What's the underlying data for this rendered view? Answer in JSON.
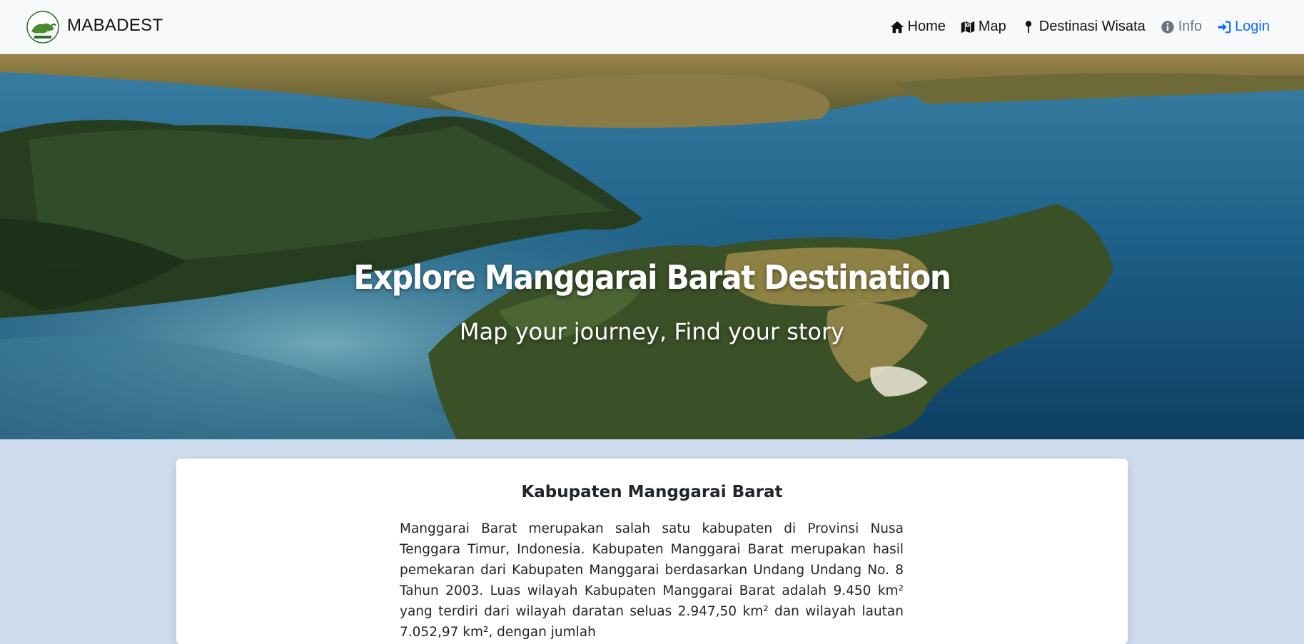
{
  "navbar": {
    "brand_name": "MABADEST",
    "logo_icon": "komodo-logo-icon",
    "links": [
      {
        "label": "Home",
        "icon": "home-icon"
      },
      {
        "label": "Map",
        "icon": "map-icon"
      },
      {
        "label": "Destinasi Wisata",
        "icon": "map-pin-icon"
      },
      {
        "label": "Info",
        "icon": "info-circle-icon"
      },
      {
        "label": "Login",
        "icon": "login-icon"
      }
    ]
  },
  "hero": {
    "title": "Explore Manggarai Barat Destination",
    "subtitle": "Map your journey, Find your story"
  },
  "card": {
    "title": "Kabupaten Manggarai Barat",
    "body": "Manggarai Barat merupakan salah satu kabupaten di Provinsi Nusa Tenggara Timur, Indonesia. Kabupaten Manggarai Barat merupakan hasil pemekaran dari Kabupaten Manggarai berdasarkan Undang Undang No. 8 Tahun 2003. Luas wilayah Kabupaten Manggarai Barat adalah 9.450 km² yang terdiri dari wilayah daratan seluas 2.947,50 km² dan wilayah lautan 7.052,97 km², dengan jumlah"
  },
  "colors": {
    "navbar_bg": "#f8f9fa",
    "page_bg": "#cfdced",
    "link_muted": "#6c757d",
    "link_primary": "#0d6efd"
  }
}
